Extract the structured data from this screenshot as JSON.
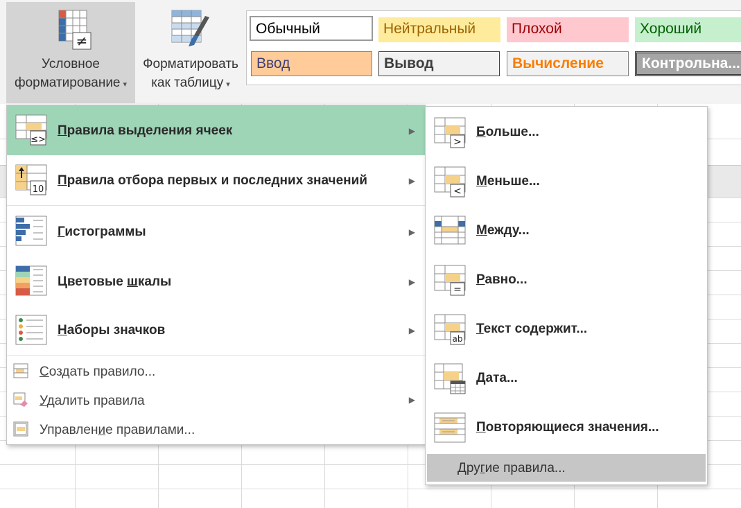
{
  "ribbon": {
    "conditional_formatting": {
      "line1": "Условное",
      "line2": "форматирование",
      "caret": "▾"
    },
    "format_as_table": {
      "line1": "Форматировать",
      "line2": "как таблицу",
      "caret": "▾"
    },
    "cell_styles": [
      {
        "label": "Обычный",
        "bg": "#ffffff",
        "color": "#000000",
        "bold": false
      },
      {
        "label": "Нейтральный",
        "bg": "#ffeb9c",
        "color": "#9c6500",
        "bold": false
      },
      {
        "label": "Плохой",
        "bg": "#ffc7ce",
        "color": "#9c0006",
        "bold": false
      },
      {
        "label": "Хороший",
        "bg": "#c6efce",
        "color": "#006100",
        "bold": false
      },
      {
        "label": "Ввод",
        "bg": "#ffcc99",
        "color": "#3f3f76",
        "bold": false
      },
      {
        "label": "Вывод",
        "bg": "#f2f2f2",
        "color": "#3f3f3f",
        "bold": true
      },
      {
        "label": "Вычисление",
        "bg": "#f2f2f2",
        "color": "#fa7d00",
        "bold": true
      },
      {
        "label": "Контрольна...",
        "bg": "#a5a5a5",
        "color": "#ffffff",
        "bold": true
      }
    ]
  },
  "menu": {
    "highlight_rules": {
      "pre": "",
      "key": "П",
      "post": "равила выделения ячеек",
      "arrow": "▶"
    },
    "top_bottom_rules": {
      "pre": "",
      "key": "П",
      "post": "равила отбора первых и последних значений",
      "arrow": "▶"
    },
    "data_bars": {
      "pre": "",
      "key": "Г",
      "post": "истограммы",
      "arrow": "▶"
    },
    "color_scales": {
      "pre": "Цветовые ",
      "key": "ш",
      "post": "калы",
      "arrow": "▶"
    },
    "icon_sets": {
      "pre": "",
      "key": "Н",
      "post": "аборы значков",
      "arrow": "▶"
    },
    "new_rule": {
      "pre": "",
      "key": "С",
      "post": "оздать правило..."
    },
    "clear_rules": {
      "pre": "",
      "key": "У",
      "post": "далить правила",
      "arrow": "▶"
    },
    "manage_rules": {
      "pre": "Управлен",
      "key": "и",
      "post": "е правилами..."
    }
  },
  "submenu": {
    "greater": {
      "pre": "",
      "key": "Б",
      "post": "ольше..."
    },
    "less": {
      "pre": "",
      "key": "М",
      "post": "еньше..."
    },
    "between": {
      "pre": "",
      "key": "М",
      "post": "ежду..."
    },
    "equal": {
      "pre": "",
      "key": "Р",
      "post": "авно..."
    },
    "text_contains": {
      "pre": "",
      "key": "Т",
      "post": "екст содержит..."
    },
    "date": {
      "pre": "",
      "key": "Д",
      "post": "ата..."
    },
    "duplicate_values": {
      "pre": "",
      "key": "П",
      "post": "овторяющиеся значения..."
    },
    "more_rules": {
      "pre": "Дру",
      "key": "г",
      "post": "ие правила..."
    }
  },
  "colors": {
    "highlight": "#9fd5b7",
    "hover": "#c6c6c6",
    "cell_yellow": "#f5d18a",
    "bar_blue": "#3d6ea8",
    "bar_red": "#d65c45"
  }
}
